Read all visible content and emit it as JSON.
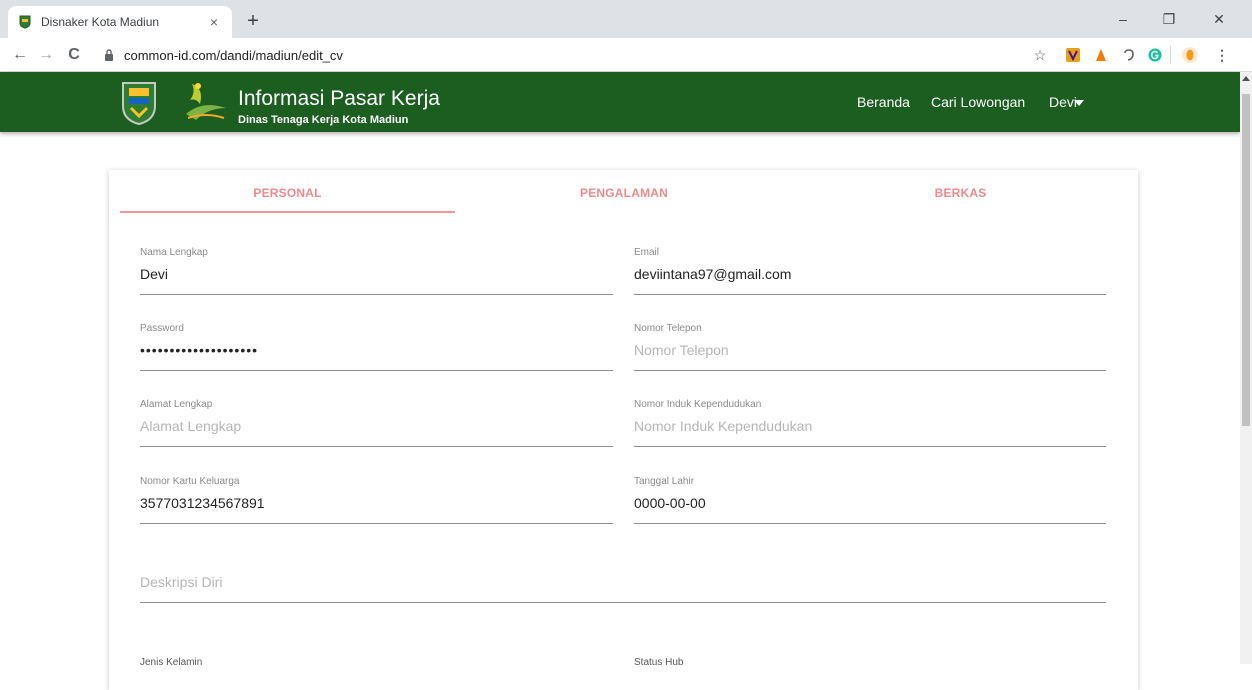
{
  "browser": {
    "tab_title": "Disnaker Kota Madiun",
    "tab_close": "×",
    "new_tab": "+",
    "minimize": "–",
    "restore": "❐",
    "close": "✕",
    "back": "←",
    "forward": "→",
    "reload": "C",
    "url": "common-id.com/dandi/madiun/edit_cv",
    "bookmark": "☆",
    "menu": "⋮"
  },
  "header": {
    "title": "Informasi Pasar Kerja",
    "subtitle": "Dinas Tenaga Kerja Kota Madiun",
    "nav": {
      "home": "Beranda",
      "search": "Cari Lowongan",
      "user": "Devi"
    },
    "color": "#1b5e20"
  },
  "tabs": {
    "personal": "PERSONAL",
    "experience": "PENGALAMAN",
    "files": "BERKAS",
    "accent": "#ef8a8a"
  },
  "form": {
    "full_name": {
      "label": "Nama Lengkap",
      "value": "Devi",
      "placeholder": ""
    },
    "email": {
      "label": "Email",
      "value": "deviintana97@gmail.com",
      "placeholder": ""
    },
    "password": {
      "label": "Password",
      "value": "••••••••••••••••••••",
      "placeholder": ""
    },
    "phone": {
      "label": "Nomor Telepon",
      "value": "",
      "placeholder": "Nomor Telepon"
    },
    "address": {
      "label": "Alamat Lengkap",
      "value": "",
      "placeholder": "Alamat Lengkap"
    },
    "nik": {
      "label": "Nomor Induk Kependudukan",
      "value": "",
      "placeholder": "Nomor Induk Kependudukan"
    },
    "kk": {
      "label": "Nomor Kartu Keluarga",
      "value": "3577031234567891",
      "placeholder": ""
    },
    "birth_date": {
      "label": "Tanggal Lahir",
      "value": "0000-00-00",
      "placeholder": ""
    },
    "description": {
      "label": "",
      "value": "",
      "placeholder": "Deskripsi Diri"
    },
    "gender": {
      "label": "Jenis Kelamin"
    },
    "status": {
      "label": "Status Hub"
    }
  }
}
